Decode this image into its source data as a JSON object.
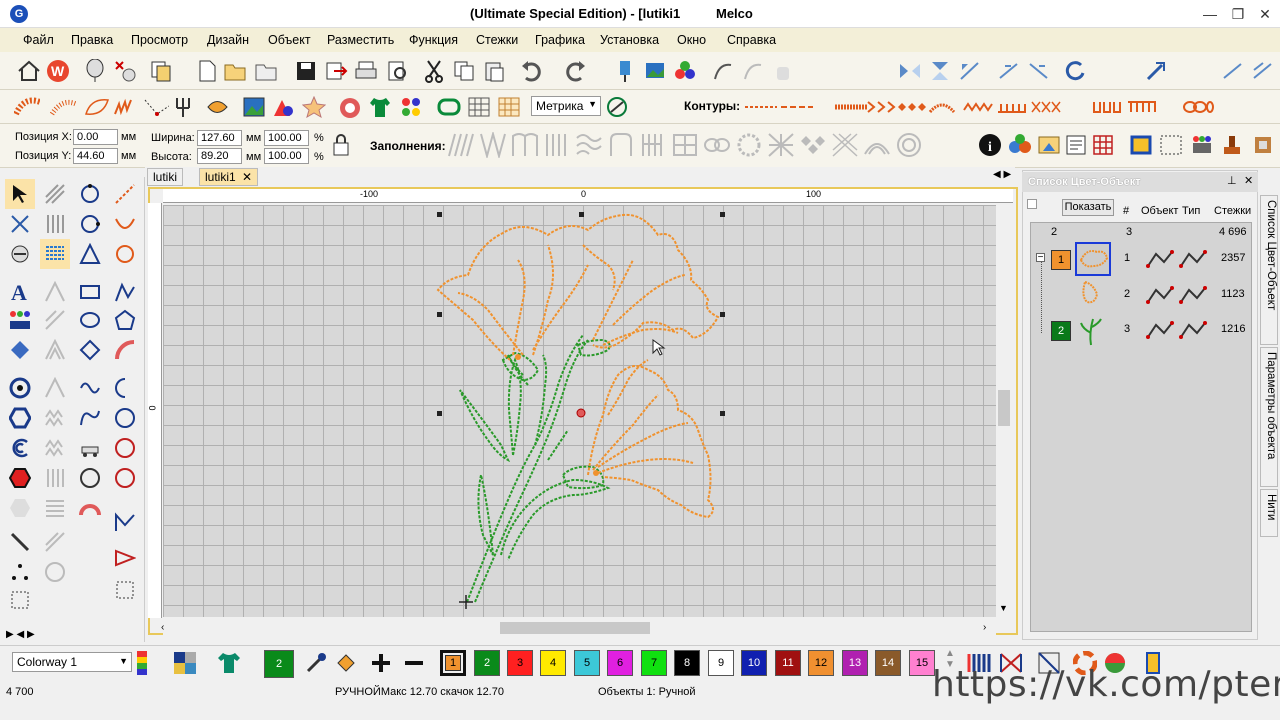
{
  "title": {
    "app_title": "(Ultimate Special Edition) - [lutiki1",
    "vendor": "Melco"
  },
  "menu": [
    "Файл",
    "Правка",
    "Просмотр",
    "Дизайн",
    "Объект",
    "Разместить",
    "Функция",
    "Стежки",
    "Графика",
    "Установка",
    "Окно",
    "Справка"
  ],
  "toolbar2": {
    "units_select": "Метрика",
    "contours_label": "Контуры:"
  },
  "props": {
    "pos_x_label": "Позиция X:",
    "pos_x": "0.00",
    "pos_y_label": "Позиция Y:",
    "pos_y": "44.60",
    "unit": "мм",
    "width_label": "Ширина:",
    "width": "127.60",
    "width_pct": "100.00",
    "height_label": "Высота:",
    "height": "89.20",
    "height_pct": "100.00",
    "pct": "%",
    "fills_label": "Заполнения:"
  },
  "view_fields": {
    "rotate_val": "0",
    "mirror_val": "0"
  },
  "tabs": [
    {
      "label": "lutiki",
      "active": false
    },
    {
      "label": "lutiki1",
      "active": true
    }
  ],
  "ruler": {
    "top_labels": [
      "-100",
      "0",
      "100"
    ],
    "left_label": "0"
  },
  "right_panel": {
    "title": "Список Цвет-Объект",
    "show_button": "Показать",
    "col_num": "#",
    "col_obj": "Объект",
    "col_type": "Тип",
    "col_stitches": "Стежки",
    "summary": {
      "colors": "2",
      "objects": "3",
      "stitches": "4 696"
    },
    "rows": [
      {
        "color_index": "1",
        "num": "1",
        "stitches": "2357",
        "color": "#f0922e"
      },
      {
        "color_index": "",
        "num": "2",
        "stitches": "1123",
        "color": "#f0922e"
      },
      {
        "color_index": "2",
        "num": "3",
        "stitches": "1216",
        "color": "#0a7a1a"
      }
    ],
    "side_tabs": [
      "Список Цвет-Объект",
      "Параметры объекта",
      "Нити"
    ]
  },
  "bottom": {
    "colorway": "Colorway 1",
    "current_color": "2",
    "swatches": [
      {
        "n": "1",
        "color": "#f0922e"
      },
      {
        "n": "2",
        "color": "#0a8a1a"
      },
      {
        "n": "3",
        "color": "#ff2020"
      },
      {
        "n": "4",
        "color": "#ffea00"
      },
      {
        "n": "5",
        "color": "#3cc8d8"
      },
      {
        "n": "6",
        "color": "#e020e0"
      },
      {
        "n": "7",
        "color": "#10e010"
      },
      {
        "n": "8",
        "color": "#000000"
      },
      {
        "n": "9",
        "color": "#ffffff"
      },
      {
        "n": "10",
        "color": "#1020b0"
      },
      {
        "n": "11",
        "color": "#a01010"
      },
      {
        "n": "12",
        "color": "#f09030"
      },
      {
        "n": "13",
        "color": "#b020b0"
      },
      {
        "n": "14",
        "color": "#8a5a2a"
      },
      {
        "n": "15",
        "color": "#ff80d0"
      }
    ]
  },
  "status": {
    "stitches": "4 700",
    "mode": "РУЧНОЙМакс 12.70 скачок 12.70",
    "objects": "Объекты 1: Ручной"
  },
  "watermark": "https://vk.com/pteris"
}
